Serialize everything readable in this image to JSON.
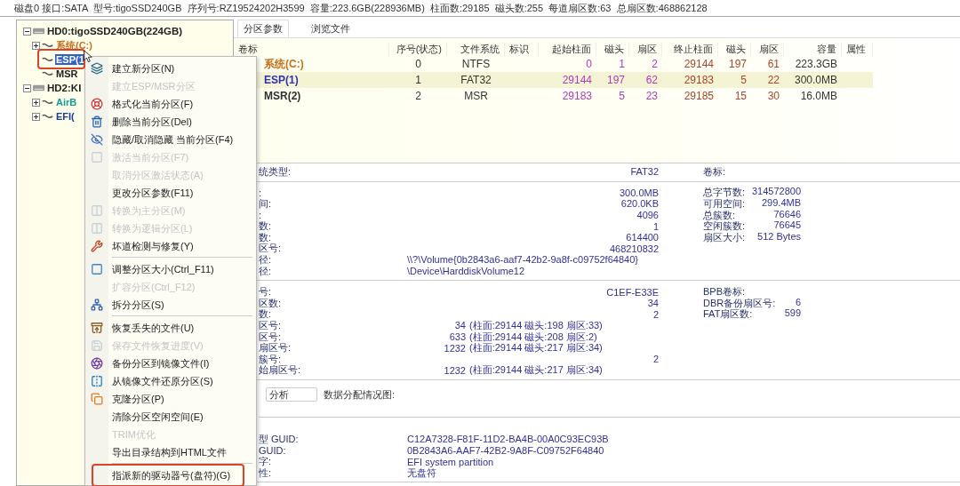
{
  "disk_info": "磁盘0 接口:SATA  型号:tigoSSD240GB  序列号:RZ19524202H3599  容量:223.6GB(228936MB)  柱面数:29185  磁头数:255  每道扇区数:63  总扇区数:468862128",
  "tree": [
    {
      "label": "HD0:tigoSSD240GB(224GB)",
      "selected": false,
      "expanded": true,
      "children": [
        {
          "label": "系统(C:)",
          "color": "#c8701c",
          "selected": false,
          "expanded": false
        },
        {
          "label": "ESP(1",
          "selected": true
        },
        {
          "label": "MSR",
          "color": "#222222",
          "selected": false
        }
      ]
    },
    {
      "label": "HD2:KI",
      "selected": false,
      "expanded": true,
      "children": [
        {
          "label": "AirB",
          "color": "#109a9a",
          "selected": false,
          "expanded": false
        },
        {
          "label": "EFI(",
          "color": "#1a3a9a",
          "selected": false,
          "expanded": false
        }
      ]
    }
  ],
  "tabs": [
    {
      "label": "分区参数",
      "selected": true
    },
    {
      "label": "浏览文件",
      "selected": false
    }
  ],
  "table": {
    "columns": [
      "卷标",
      "序号(状态)",
      "文件系统",
      "标识",
      "起始柱面",
      "磁头",
      "扇区",
      "终止柱面",
      "磁头",
      "扇区",
      "容量",
      "属性"
    ],
    "rows": [
      {
        "label": "系统(C:)",
        "color": "#c8701c",
        "selected": false,
        "number": "0",
        "fs": "NTFS",
        "start_cyl": "0",
        "start_head": "1",
        "start_sector": "2",
        "end_cyl": "29144",
        "end_head": "197",
        "end_sector": "61",
        "capacity": "223.3GB"
      },
      {
        "label": "ESP(1)",
        "color": "#3030b0",
        "selected": true,
        "number": "1",
        "fs": "FAT32",
        "start_cyl": "29144",
        "start_head": "197",
        "start_sector": "62",
        "end_cyl": "29183",
        "end_head": "5",
        "end_sector": "22",
        "capacity": "300.0MB"
      },
      {
        "label": "MSR(2)",
        "color": "#303030",
        "selected": false,
        "number": "2",
        "fs": "MSR",
        "start_cyl": "29183",
        "start_head": "5",
        "start_sector": "23",
        "end_cyl": "29185",
        "end_head": "15",
        "end_sector": "30",
        "capacity": "16.0MB"
      }
    ]
  },
  "info_sections": [
    {
      "kind": "rows",
      "rows": [
        {
          "kind": "pair",
          "label": "统类型:",
          "value": "FAT32",
          "label2": "卷标:"
        }
      ]
    },
    {
      "kind": "rows",
      "rows": [
        {
          "kind": "pair",
          "label": ":",
          "value": "300.0MB",
          "label2": "总字节数:",
          "value2": "314572800"
        },
        {
          "kind": "pair",
          "label": "间:",
          "value": "620.0KB",
          "label2": "可用空间:",
          "value2": "299.4MB"
        },
        {
          "kind": "pair",
          "label": ":",
          "value": "4096",
          "label2": "总簇数:",
          "value2": "76646"
        },
        {
          "kind": "pair",
          "label": "数:",
          "value": "1",
          "label2": "空闲簇数:",
          "value2": "76645"
        },
        {
          "kind": "pair",
          "label": "数:",
          "value": "614400",
          "label2": "扇区大小:",
          "value2": "512 Bytes"
        },
        {
          "kind": "pair",
          "label": "区号:",
          "value": "468210832"
        },
        {
          "kind": "wide",
          "label": "径:",
          "value": "\\\\?\\Volume{0b2843a6-aaf7-42b2-9a8f-c09752f64840}"
        },
        {
          "kind": "wide",
          "label": "径:",
          "value": "\\Device\\HarddiskVolume12"
        }
      ]
    },
    {
      "kind": "rows",
      "rows": [
        {
          "kind": "pair",
          "label": "号:",
          "value": "C1EF-E33E",
          "label2": "BPB卷标:"
        },
        {
          "kind": "pair",
          "label": "区数:",
          "value": "34",
          "label2": "DBR备份扇区号:",
          "value2": "6"
        },
        {
          "kind": "pair",
          "label": "数:",
          "value": "2",
          "label2": "FAT扇区数:",
          "value2": "599"
        },
        {
          "kind": "location",
          "label": "区号:",
          "value": "34",
          "detail": "(柱面:29144 磁头:198 扇区:33)"
        },
        {
          "kind": "location",
          "label": "区号:",
          "value": "633",
          "detail": "(柱面:29144 磁头:208 扇区:2)"
        },
        {
          "kind": "location",
          "label": "扇区号:",
          "value": "1232",
          "detail": "(柱面:29144 磁头:217 扇区:34)"
        },
        {
          "kind": "pair",
          "label": "簇号:",
          "value": "2"
        },
        {
          "kind": "location",
          "label": "始扇区号:",
          "value": "1232",
          "detail": "(柱面:29144 磁头:217 扇区:34)"
        }
      ]
    },
    {
      "kind": "analysis",
      "button": "分析",
      "label": "数据分配情况图:"
    },
    {
      "kind": "rows",
      "rows": [
        {
          "kind": "wide",
          "label": "型 GUID:",
          "value": "C12A7328-F81F-11D2-BA4B-00A0C93EC93B"
        },
        {
          "kind": "wide",
          "label": "GUID:",
          "value": "0B2843A6-AAF7-42B2-9A8F-C09752F64840"
        },
        {
          "kind": "wide",
          "label": "字:",
          "value": "EFI system partition"
        },
        {
          "kind": "wide",
          "label": "性:",
          "value": "无盘符"
        }
      ]
    }
  ],
  "context_menu": [
    {
      "kind": "item",
      "label": "建立新分区(N)",
      "disabled": false
    },
    {
      "kind": "item",
      "label": "建立ESP/MSR分区",
      "disabled": true
    },
    {
      "kind": "item",
      "label": "格式化当前分区(F)",
      "disabled": false
    },
    {
      "kind": "item",
      "label": "删除当前分区(Del)",
      "disabled": false
    },
    {
      "kind": "item",
      "label": "隐藏/取消隐藏 当前分区(F4)",
      "disabled": false
    },
    {
      "kind": "item",
      "label": "激活当前分区(F7)",
      "disabled": true
    },
    {
      "kind": "item",
      "label": "取消分区激活状态(A)",
      "disabled": true
    },
    {
      "kind": "item",
      "label": "更改分区参数(F11)",
      "disabled": false
    },
    {
      "kind": "item",
      "label": "转换为主分区(M)",
      "disabled": true
    },
    {
      "kind": "item",
      "label": "转换为逻辑分区(L)",
      "disabled": true
    },
    {
      "kind": "item",
      "label": "坏道检测与修复(Y)",
      "disabled": false
    },
    {
      "kind": "separator"
    },
    {
      "kind": "item",
      "label": "调整分区大小(Ctrl_F11)",
      "disabled": false
    },
    {
      "kind": "item",
      "label": "扩容分区(Ctrl_F12)",
      "disabled": true
    },
    {
      "kind": "item",
      "label": "拆分分区(S)",
      "disabled": false
    },
    {
      "kind": "separator"
    },
    {
      "kind": "item",
      "label": "恢复丢失的文件(U)",
      "disabled": false
    },
    {
      "kind": "item",
      "label": "保存文件恢复进度(V)",
      "disabled": true
    },
    {
      "kind": "item",
      "label": "备份分区到镜像文件(I)",
      "disabled": false
    },
    {
      "kind": "item",
      "label": "从镜像文件还原分区(S)",
      "disabled": false
    },
    {
      "kind": "item",
      "label": "克隆分区(P)",
      "disabled": false
    },
    {
      "kind": "item",
      "label": "清除分区空闲空间(E)",
      "disabled": false
    },
    {
      "kind": "item",
      "label": "TRIM优化",
      "disabled": true
    },
    {
      "kind": "item",
      "label": "导出目录结构到HTML文件",
      "disabled": false
    },
    {
      "kind": "separator"
    },
    {
      "kind": "item",
      "label": "指派新的驱动器号(盘符)(G)",
      "disabled": false
    }
  ]
}
